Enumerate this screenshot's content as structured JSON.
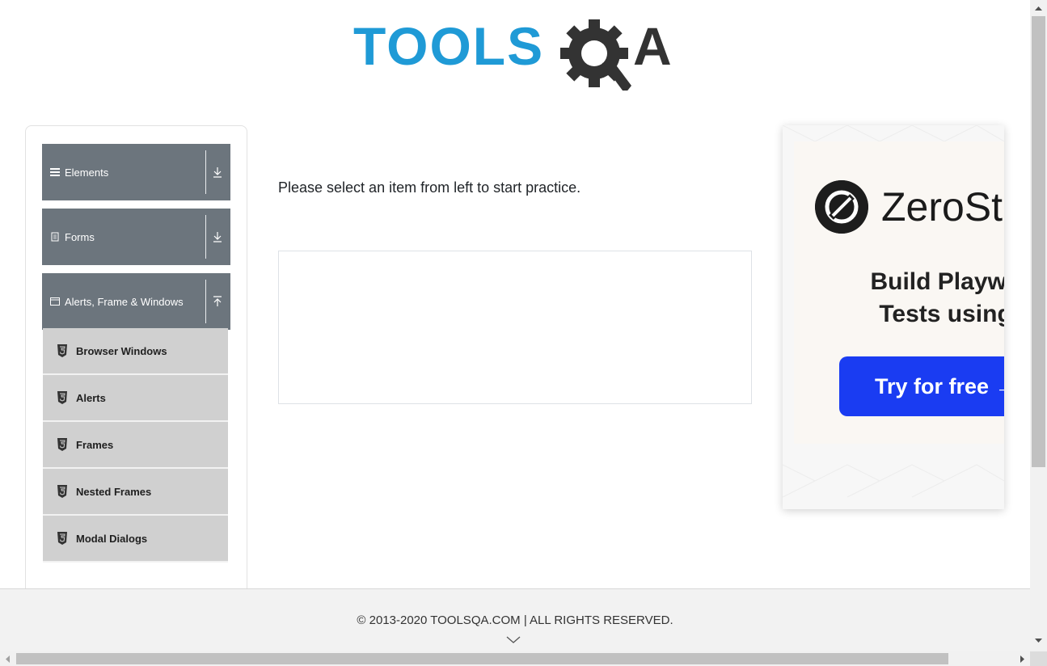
{
  "header": {
    "logo_text_left": "TOOLS",
    "logo_text_right": "QA",
    "logo_colors": {
      "primary": "#1f9ad6",
      "secondary": "#333333"
    }
  },
  "sidebar": {
    "groups": [
      {
        "label": "Elements",
        "icon": "hamburger-icon",
        "state": "collapsed"
      },
      {
        "label": "Forms",
        "icon": "document-icon",
        "state": "collapsed"
      },
      {
        "label": "Alerts, Frame & Windows",
        "icon": "window-icon",
        "state": "expanded"
      }
    ],
    "items": [
      {
        "label": "Browser Windows"
      },
      {
        "label": "Alerts"
      },
      {
        "label": "Frames"
      },
      {
        "label": "Nested Frames"
      },
      {
        "label": "Modal Dialogs"
      }
    ],
    "colors": {
      "group_bg": "#6c757d",
      "item_bg": "#d0d0d0"
    }
  },
  "main": {
    "instruction": "Please select an item from left to start practice."
  },
  "ad": {
    "brand": "ZeroSte",
    "headline_line1": "Build Playwrigl",
    "headline_line2": "Tests using A",
    "cta": "Try for free →",
    "cta_color": "#1a3cf2"
  },
  "footer": {
    "text": "© 2013-2020 TOOLSQA.COM | ALL RIGHTS RESERVED."
  }
}
